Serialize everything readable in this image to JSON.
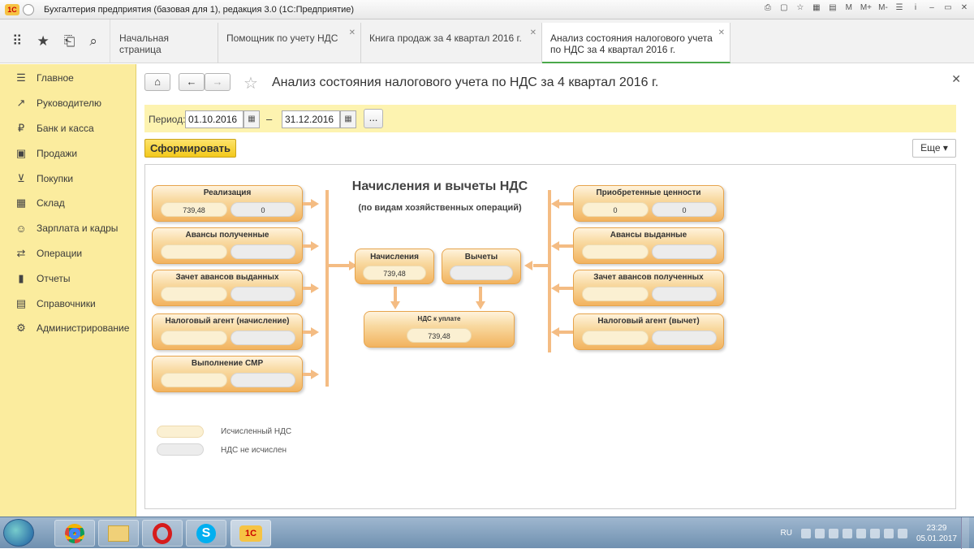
{
  "window": {
    "title": "Бухгалтерия предприятия (базовая для 1), редакция 3.0  (1С:Предприятие)",
    "tools": [
      "M",
      "M+",
      "M-",
      "☰",
      "i"
    ]
  },
  "tabs": [
    {
      "label": "Начальная страница"
    },
    {
      "label": "Помощник по учету НДС"
    },
    {
      "label": "Книга продаж за 4 квартал 2016 г."
    },
    {
      "label": "Анализ состояния налогового учета по НДС за 4 квартал 2016 г."
    }
  ],
  "sidebar": {
    "items": [
      {
        "label": "Главное",
        "icon": "☰"
      },
      {
        "label": "Руководителю",
        "icon": "↗"
      },
      {
        "label": "Банк и касса",
        "icon": "₽"
      },
      {
        "label": "Продажи",
        "icon": "▣"
      },
      {
        "label": "Покупки",
        "icon": "⊻"
      },
      {
        "label": "Склад",
        "icon": "▦"
      },
      {
        "label": "Зарплата и кадры",
        "icon": "☺"
      },
      {
        "label": "Операции",
        "icon": "⇄"
      },
      {
        "label": "Отчеты",
        "icon": "▮"
      },
      {
        "label": "Справочники",
        "icon": "▤"
      },
      {
        "label": "Администрирование",
        "icon": "⚙"
      }
    ]
  },
  "page": {
    "title": "Анализ состояния налогового учета по НДС за 4 квартал 2016 г.",
    "period_label": "Период:",
    "date_from": "01.10.2016",
    "date_to": "31.12.2016",
    "dash": "–",
    "ellipsis": "...",
    "generate_label": "Сформировать",
    "more_label": "Еще ▾"
  },
  "report": {
    "title": "Начисления и вычеты НДС",
    "subtitle": "(по видам хозяйственных операций)",
    "left": [
      {
        "title": "Реализация",
        "v1": "739,48",
        "v2": "0"
      },
      {
        "title": "Авансы полученные",
        "v1": "",
        "v2": ""
      },
      {
        "title": "Зачет авансов выданных",
        "v1": "",
        "v2": ""
      },
      {
        "title": "Налоговый агент (начисление)",
        "v1": "",
        "v2": ""
      },
      {
        "title": "Выполнение СМР",
        "v1": "",
        "v2": ""
      }
    ],
    "right": [
      {
        "title": "Приобретенные ценности",
        "v1": "0",
        "v2": "0"
      },
      {
        "title": "Авансы выданные",
        "v1": "",
        "v2": ""
      },
      {
        "title": "Зачет авансов полученных",
        "v1": "",
        "v2": ""
      },
      {
        "title": "Налоговый агент (вычет)",
        "v1": "",
        "v2": ""
      }
    ],
    "accruals": {
      "title": "Начисления",
      "value": "739,48"
    },
    "deductions": {
      "title": "Вычеты",
      "value": ""
    },
    "payable": {
      "title": "НДС к уплате",
      "value": "739,48"
    },
    "legend": [
      {
        "label": "Исчисленный НДС",
        "color": "#fbf0d2"
      },
      {
        "label": "НДС не исчислен",
        "color": "#ececec"
      }
    ]
  },
  "taskbar": {
    "lang": "RU",
    "time": "23:29",
    "date": "05.01.2017"
  }
}
